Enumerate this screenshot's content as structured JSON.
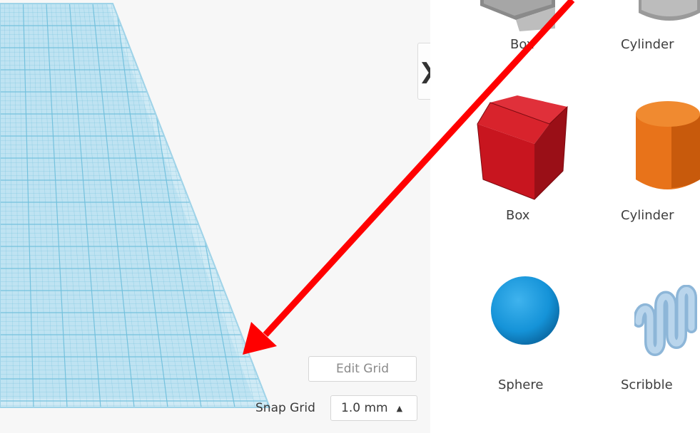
{
  "workplane": {
    "collapse_glyph": "❯",
    "edit_grid_label": "Edit Grid",
    "snap_grid_label": "Snap Grid",
    "snap_grid_value": "1.0 mm",
    "snap_grid_caret": "▲"
  },
  "library": {
    "top_row": [
      {
        "label": "Box",
        "icon": "box-gray-icon"
      },
      {
        "label": "Cylinder",
        "icon": "cylinder-gray-icon"
      }
    ],
    "row2": [
      {
        "label": "Box",
        "icon": "box-red-icon"
      },
      {
        "label": "Cylinder",
        "icon": "cylinder-orange-icon"
      }
    ],
    "row3": [
      {
        "label": "Sphere",
        "icon": "sphere-blue-icon"
      },
      {
        "label": "Scribble",
        "icon": "scribble-icon"
      }
    ]
  },
  "annotation": {
    "color": "#ff0000",
    "icon": "red-arrow-annotation"
  },
  "colors": {
    "grid": "#bfe4f2",
    "grid_line": "#7ec8e0",
    "box_red": "#c8151f",
    "cylinder_orange": "#e8731a",
    "sphere_blue": "#1593d8",
    "scribble": "#a9cbe6"
  }
}
